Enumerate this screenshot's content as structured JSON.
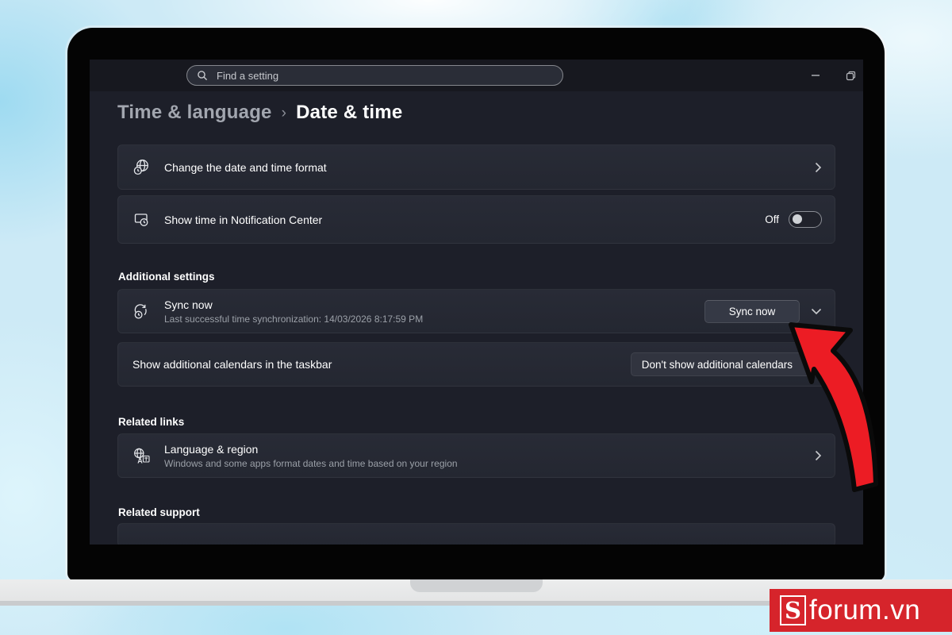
{
  "titlebar": {
    "search_placeholder": "Find a setting"
  },
  "breadcrumb": {
    "parent": "Time & language",
    "separator": "›",
    "current": "Date & time"
  },
  "sections": {
    "additional_settings": "Additional settings",
    "related_links": "Related links",
    "related_support": "Related support"
  },
  "rows": {
    "date_format": {
      "label": "Change the date and time format"
    },
    "notification_center": {
      "label": "Show time in Notification Center",
      "toggle_label": "Off",
      "toggle_state": "off"
    },
    "sync": {
      "title": "Sync now",
      "subtitle": "Last successful time synchronization: 14/03/2026 8:17:59 PM",
      "button_label": "Sync now"
    },
    "calendars": {
      "label": "Show additional calendars in the taskbar",
      "dropdown_value": "Don't show additional calendars"
    },
    "language_region": {
      "title": "Language & region",
      "subtitle": "Windows and some apps format dates and time based on your region"
    }
  },
  "icons": {
    "search": "magnifier",
    "minimize": "dash",
    "restore": "overlapping-squares",
    "date_format": "globe-with-clock",
    "notification_center": "notification-panel-with-clock",
    "sync": "sync-arrows-with-clock",
    "language_region": "globe-translate",
    "chevron_right": "›",
    "chevron_down": "⌄"
  },
  "watermark": {
    "logo_s": "S",
    "logo_text": "forum.vn"
  },
  "colors": {
    "arrow_red": "#ec1c24",
    "logo_red": "#d6242b",
    "screen_bg": "#1d1f29",
    "card_bg": "#262935"
  }
}
